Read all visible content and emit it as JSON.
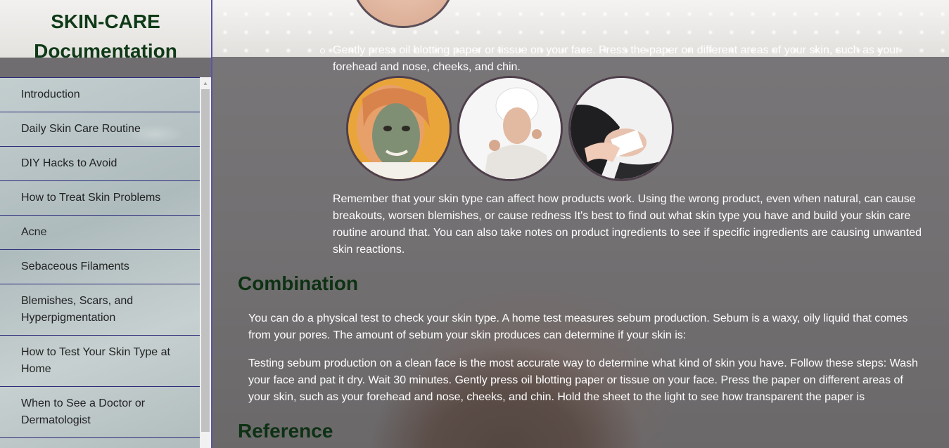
{
  "sidebar": {
    "title": "SKIN-CARE Documentation",
    "items": [
      {
        "label": "Introduction"
      },
      {
        "label": "Daily Skin Care Routine"
      },
      {
        "label": "DIY Hacks to Avoid"
      },
      {
        "label": "How to Treat Skin Problems"
      },
      {
        "label": "Acne"
      },
      {
        "label": "Sebaceous Filaments"
      },
      {
        "label": "Blemishes, Scars, and Hyperpigmentation"
      },
      {
        "label": "How to Test Your Skin Type at Home"
      },
      {
        "label": "When to See a Doctor or Dermatologist"
      }
    ]
  },
  "main": {
    "bullet_text": "Gently press oil blotting paper or tissue on your face. Press the paper on different areas of your skin, such as your forehead and nose, cheeks, and chin.",
    "images": [
      {
        "icon": "clay-mask-photo-icon"
      },
      {
        "icon": "towel-face-photo-icon"
      },
      {
        "icon": "facial-treatment-photo-icon"
      }
    ],
    "remember_text": "Remember that your skin type can affect how products work. Using the wrong product, even when natural, can cause breakouts, worsen blemishes, or cause redness It's best to find out what skin type you have and build your skin care routine around that. You can also take notes on product ingredients to see if specific ingredients are causing unwanted skin reactions.",
    "combination": {
      "heading": "Combination",
      "para1": "You can do a physical test to check your skin type. A home test measures sebum production. Sebum is a waxy, oily liquid that comes from your pores. The amount of sebum your skin produces can determine if your skin is:",
      "para2": "Testing sebum production on a clean face is the most accurate way to determine what kind of skin you have. Follow these steps: Wash your face and pat it dry. Wait 30 minutes. Gently press oil blotting paper or tissue on your face. Press the paper on different areas of your skin, such as your forehead and nose, cheeks, and chin. Hold the sheet to the light to see how transparent the paper is"
    },
    "reference": {
      "heading": "Reference"
    }
  }
}
